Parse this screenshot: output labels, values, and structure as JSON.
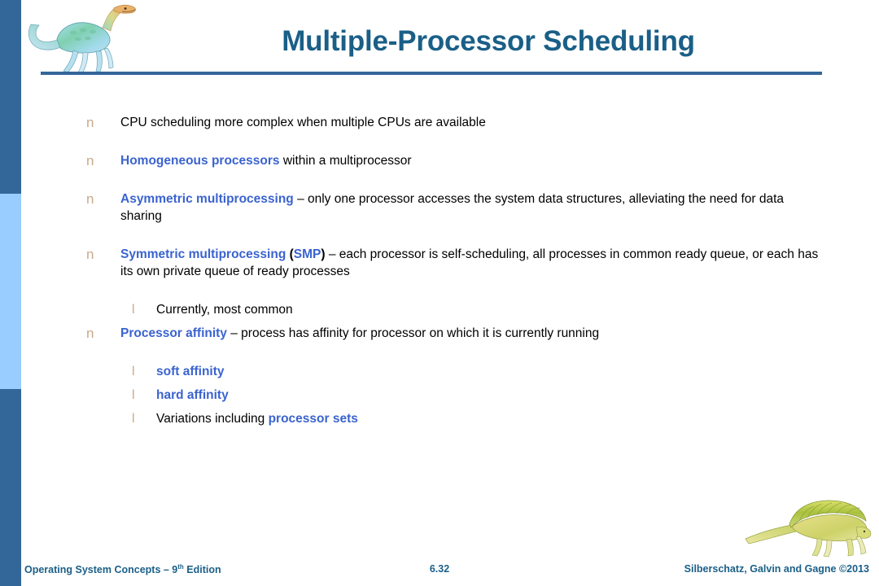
{
  "slide": {
    "title": "Multiple-Processor Scheduling",
    "bullet_marker": "n",
    "sub_marker": "l",
    "accent_blue": "#3a63cf",
    "title_color": "#1a5f87",
    "bar_dark": "#336699",
    "bar_light": "#99ccff",
    "marker_color": "#c9a98c"
  },
  "bullets": [
    {
      "marker": "n",
      "parts": [
        {
          "text": "CPU scheduling more complex when multiple CPUs are available",
          "style": "plain"
        }
      ]
    },
    {
      "marker": "n",
      "parts": [
        {
          "text": "Homogeneous processors",
          "style": "key"
        },
        {
          "text": " within a multiprocessor",
          "style": "plain"
        }
      ]
    },
    {
      "marker": "n",
      "parts": [
        {
          "text": "Asymmetric multiprocessing",
          "style": "key"
        },
        {
          "text": " – only one processor accesses the system data structures, alleviating the need for data sharing",
          "style": "plain"
        }
      ]
    },
    {
      "marker": "n",
      "parts": [
        {
          "text": "Symmetric multiprocessing",
          "style": "key"
        },
        {
          "text": " (",
          "style": "plain-bold"
        },
        {
          "text": "SMP",
          "style": "key"
        },
        {
          "text": ")",
          "style": "plain-bold"
        },
        {
          "text": " – each processor is self-scheduling, all processes in common ready queue, or each has its own private queue of ready processes",
          "style": "plain"
        }
      ],
      "subs": [
        {
          "marker": "l",
          "parts": [
            {
              "text": "Currently, most common",
              "style": "plain"
            }
          ]
        }
      ]
    },
    {
      "marker": "n",
      "parts": [
        {
          "text": "Processor affinity",
          "style": "key"
        },
        {
          "text": " – process has affinity for processor on which it is currently running",
          "style": "plain"
        }
      ],
      "subs": [
        {
          "marker": "l",
          "parts": [
            {
              "text": "soft affinity",
              "style": "key"
            }
          ]
        },
        {
          "marker": "l",
          "parts": [
            {
              "text": "hard affinity",
              "style": "key"
            }
          ]
        },
        {
          "marker": "l",
          "parts": [
            {
              "text": "Variations including ",
              "style": "plain"
            },
            {
              "text": "processor sets",
              "style": "key"
            }
          ]
        }
      ]
    }
  ],
  "footer": {
    "left_main": "Operating System Concepts – 9",
    "left_sup": "th",
    "left_tail": " Edition",
    "page": "6.32",
    "right": "Silberschatz, Galvin and Gagne ©2013"
  }
}
